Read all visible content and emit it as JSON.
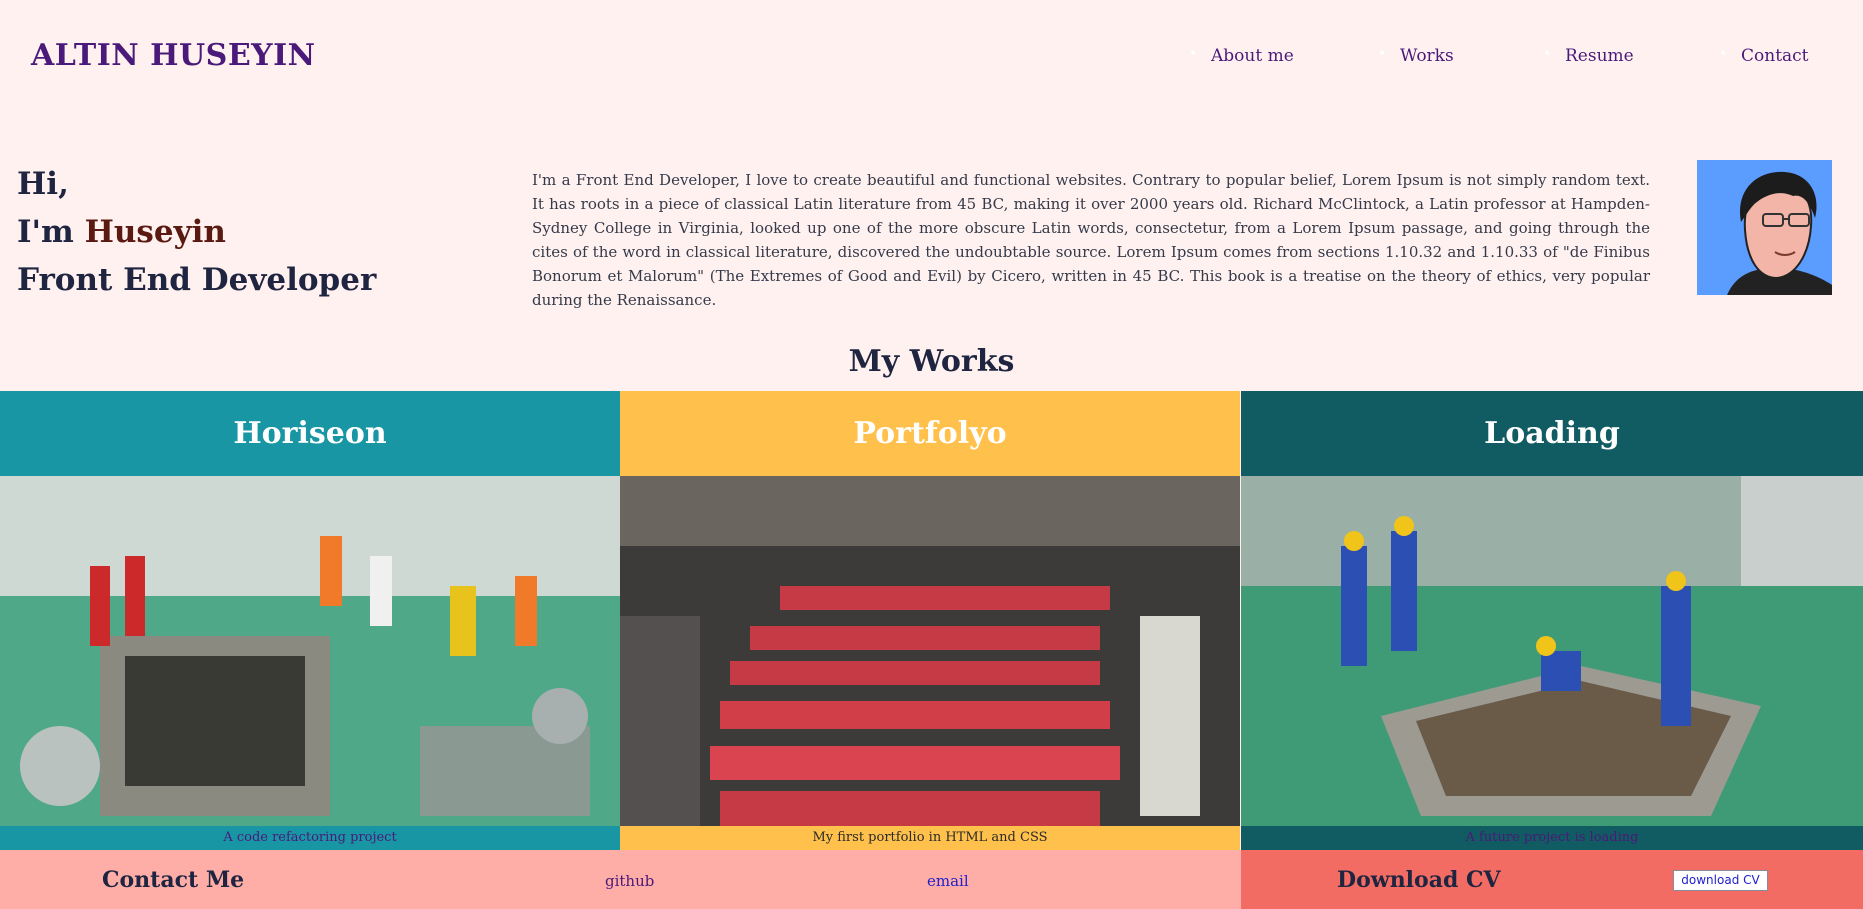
{
  "header": {
    "brand": "ALTIN HUSEYIN",
    "nav": [
      "About me",
      "Works",
      "Resume",
      "Contact"
    ]
  },
  "intro": {
    "line1": "Hi,",
    "line2_prefix": "I'm ",
    "line2_name": "Huseyin",
    "line3": "Front End Developer"
  },
  "about": "I'm a Front End Developer, I love to create beautiful and functional websites. Contrary to popular belief, Lorem Ipsum is not simply random text. It has roots in a piece of classical Latin literature from 45 BC, making it over 2000 years old. Richard McClintock, a Latin professor at Hampden-Sydney College in Virginia, looked up one of the more obscure Latin words, consectetur, from a Lorem Ipsum passage, and going through the cites of the word in classical literature, discovered the undoubtable source. Lorem Ipsum comes from sections 1.10.32 and 1.10.33 of \"de Finibus Bonorum et Malorum\" (The Extremes of Good and Evil) by Cicero, written in 45 BC. This book is a treatise on the theory of ethics, very popular during the Renaissance.",
  "works": {
    "title": "My Works",
    "items": [
      {
        "name": "Horiseon",
        "caption": "A code refactoring project"
      },
      {
        "name": "Portfolyo",
        "caption": "My first portfolio in HTML and CSS"
      },
      {
        "name": "Loading",
        "caption": "A future project is loading"
      }
    ]
  },
  "footer": {
    "contact_title": "Contact Me",
    "github": "github",
    "email": "email",
    "cv_title": "Download CV",
    "cv_button": "download CV"
  },
  "colors": {
    "background": "#fff1ef",
    "brand": "#4a1a7a",
    "card_teal": "#1896a4",
    "card_yellow": "#ffc14b",
    "card_dark_teal": "#115b62",
    "footer_pink": "#ffaea7",
    "footer_coral": "#f36c63"
  }
}
